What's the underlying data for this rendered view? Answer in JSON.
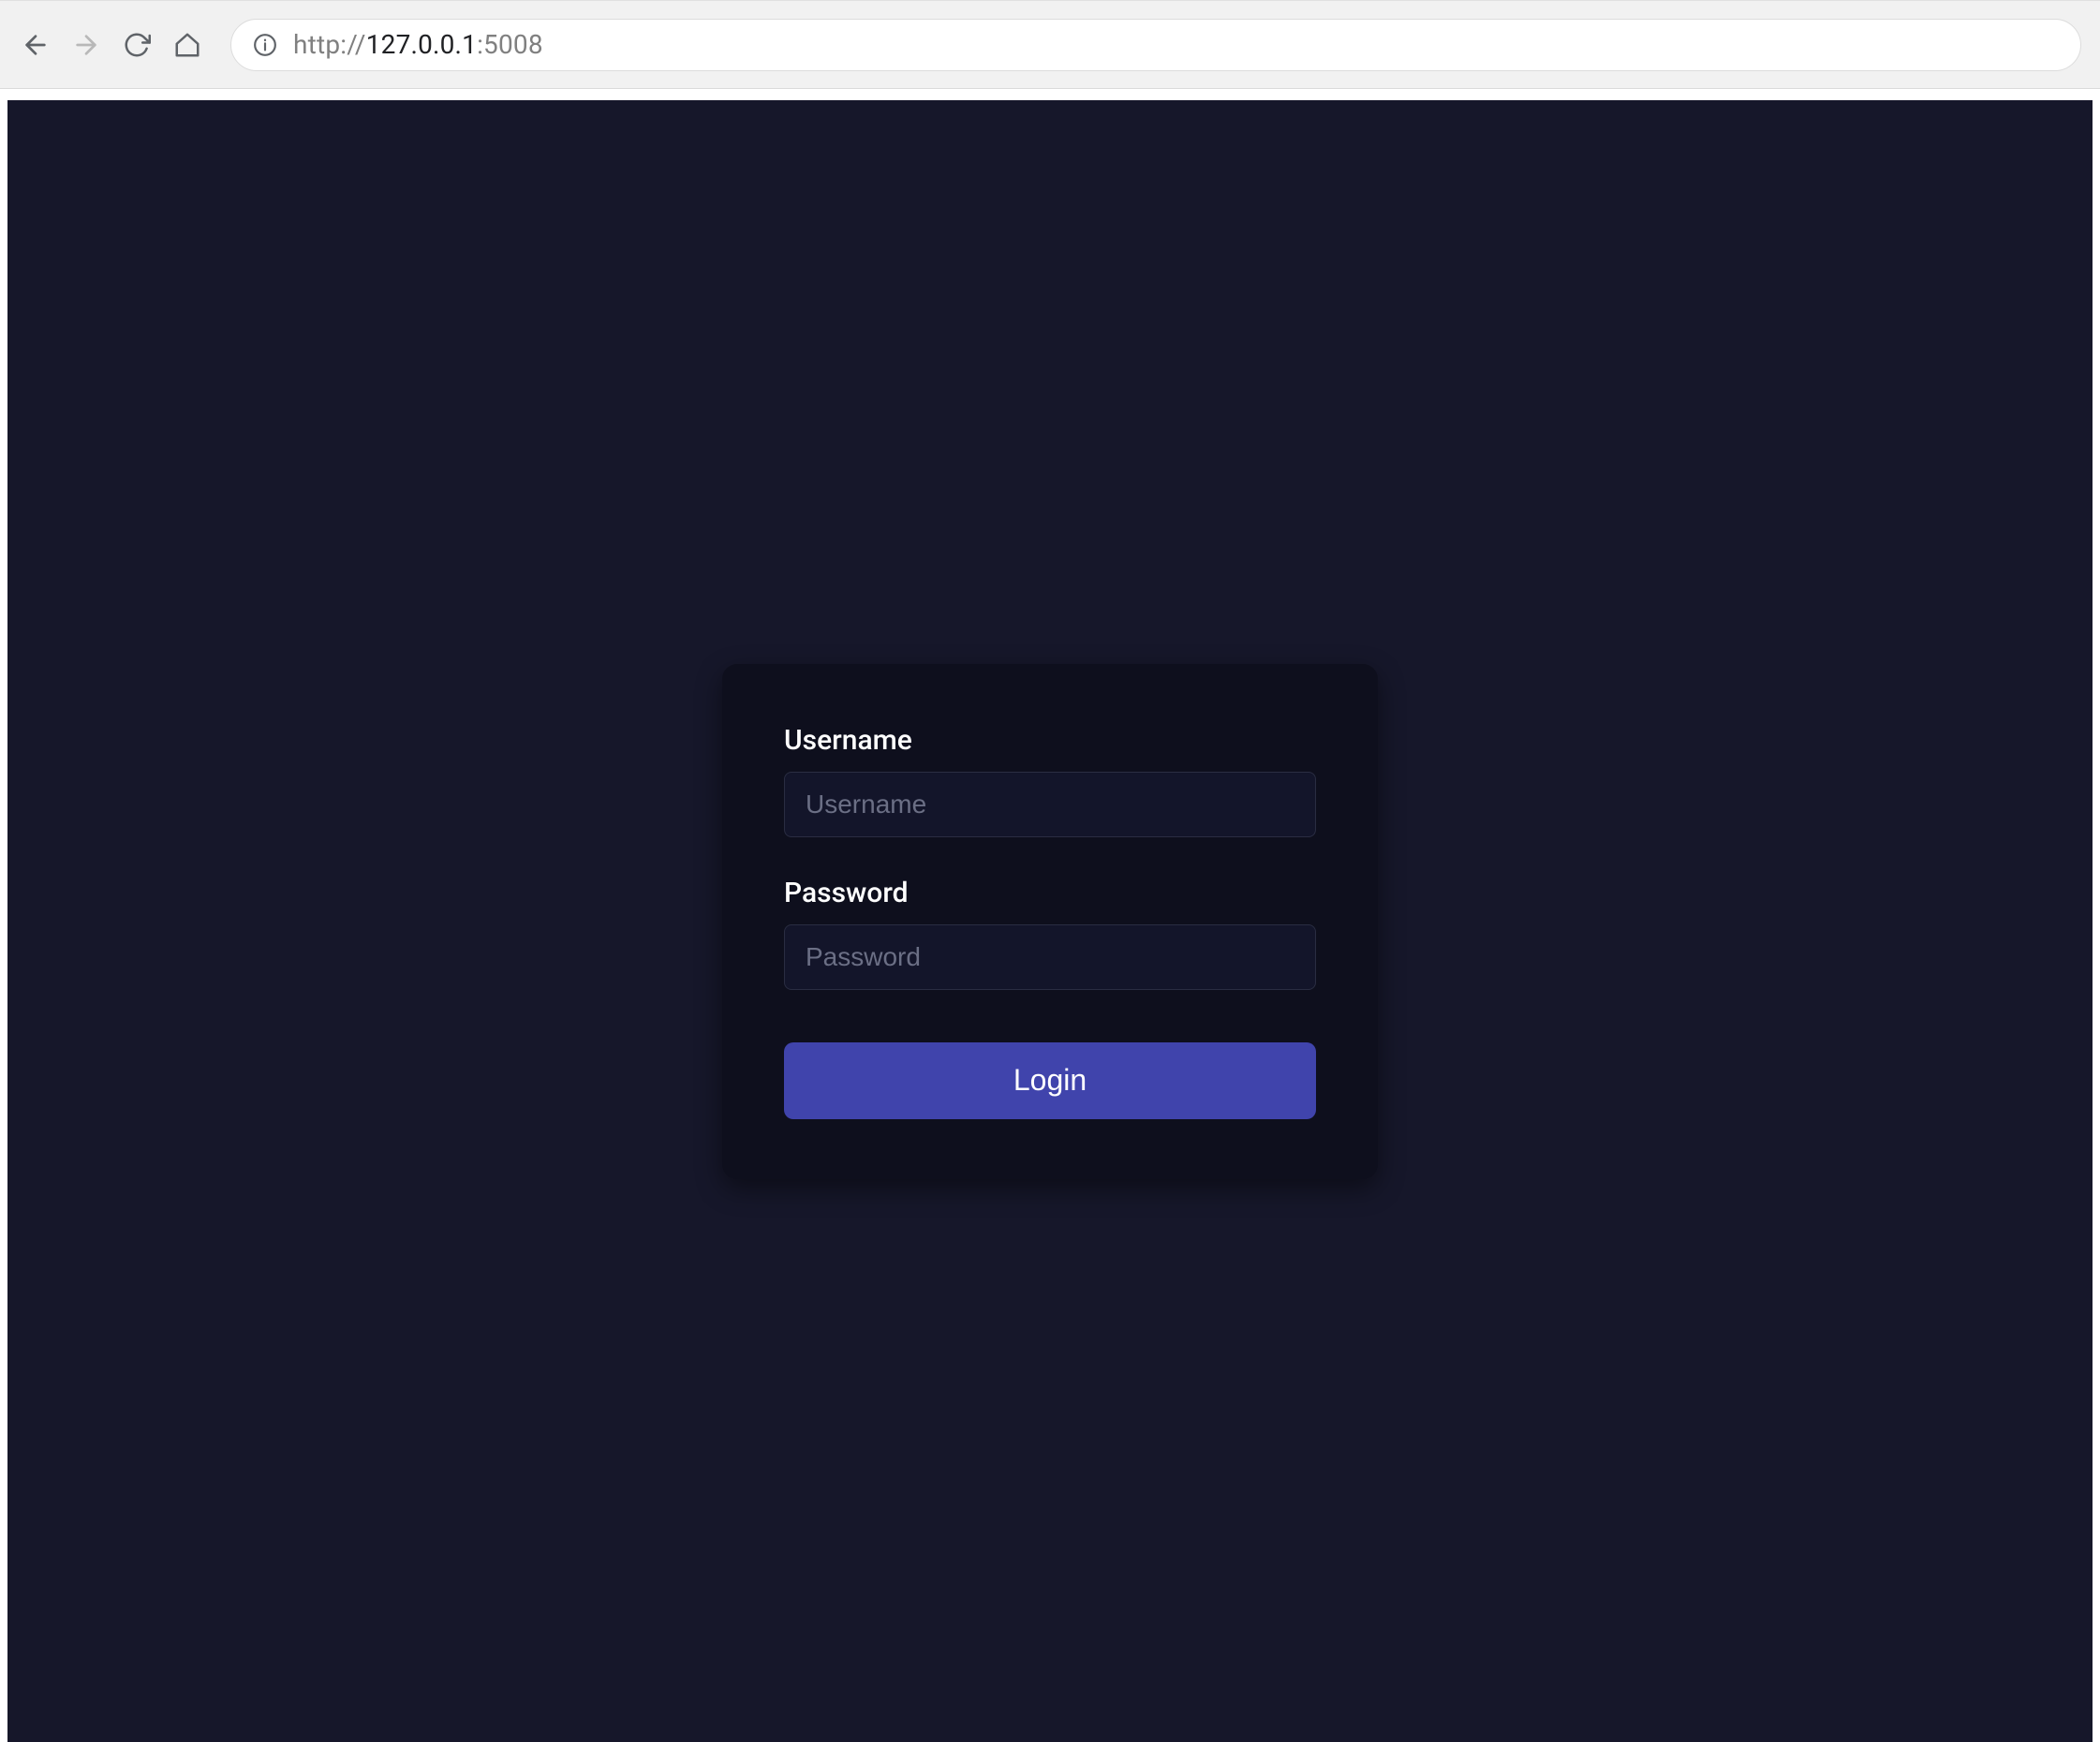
{
  "browser": {
    "url_scheme": "http://",
    "url_host": "127.0.0.1",
    "url_port": ":5008"
  },
  "login": {
    "username_label": "Username",
    "username_placeholder": "Username",
    "username_value": "",
    "password_label": "Password",
    "password_placeholder": "Password",
    "password_value": "",
    "submit_label": "Login"
  }
}
